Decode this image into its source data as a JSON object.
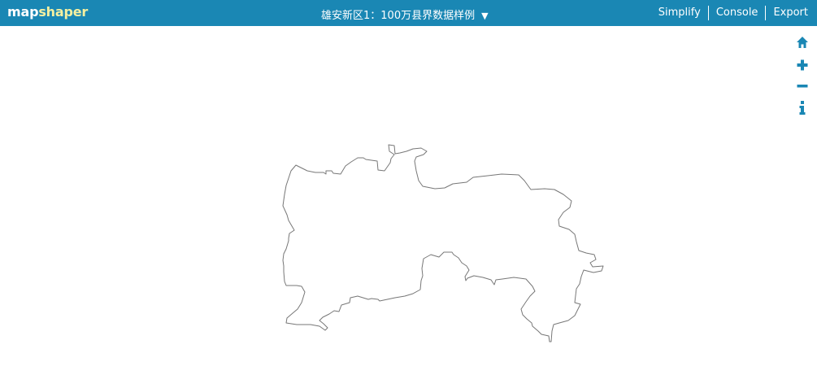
{
  "app": {
    "logo_map": "map",
    "logo_shaper": "shaper"
  },
  "layer": {
    "name": "雄安新区1：100万县界数据样例"
  },
  "menu": {
    "simplify": "Simplify",
    "console": "Console",
    "export": "Export"
  },
  "colors": {
    "topbar": "#1a87b4",
    "logo_accent": "#f5f0a0",
    "tool_icon": "#1a87b4",
    "boundary_stroke": "#777777"
  },
  "tools": [
    "home-icon",
    "zoom-in-icon",
    "zoom-out-icon",
    "info-icon"
  ]
}
